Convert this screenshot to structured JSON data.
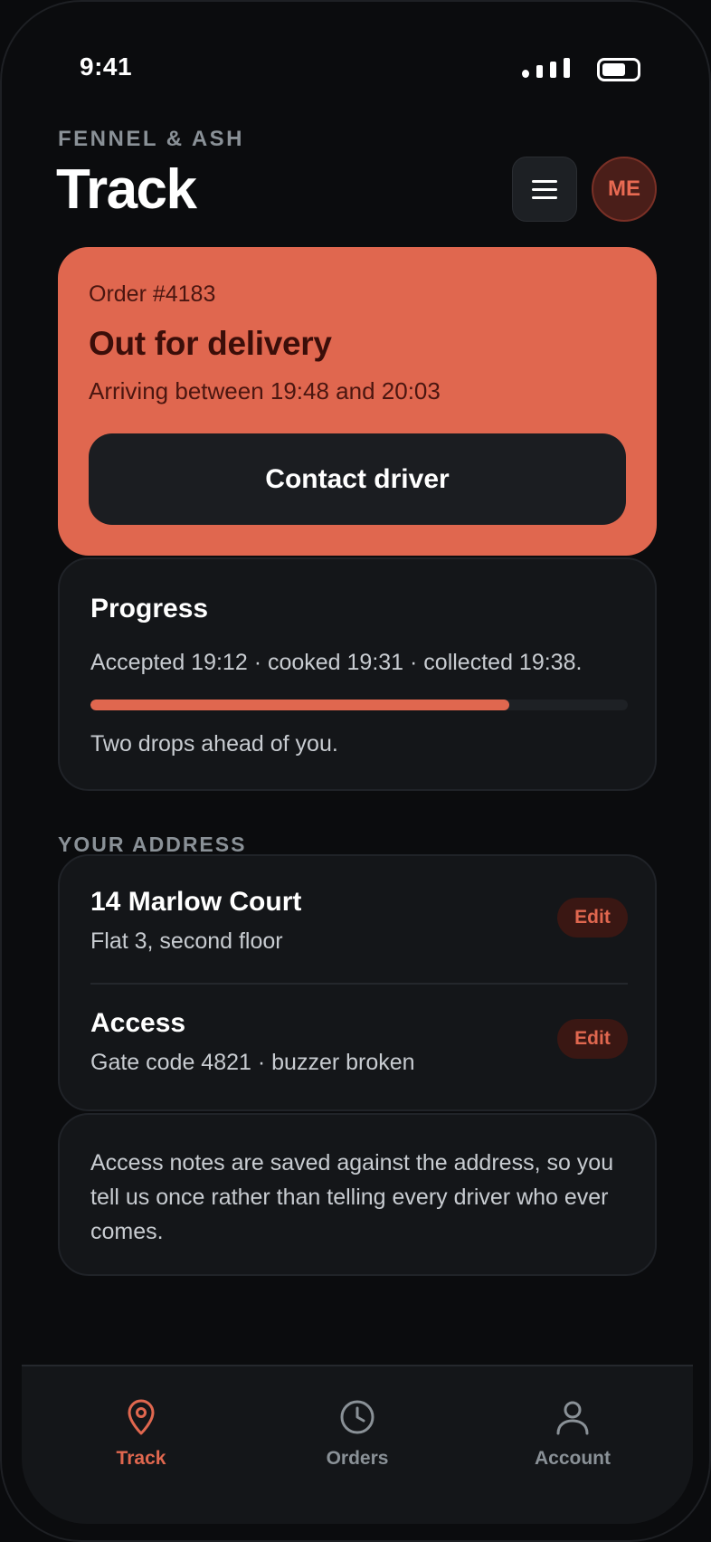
{
  "status_bar": {
    "time": "9:41"
  },
  "header": {
    "brand": "FENNEL & ASH",
    "title": "Track",
    "avatar_initials": "ME"
  },
  "order": {
    "number": "Order #4183",
    "status": "Out for delivery",
    "eta": "Arriving between 19:48 and 20:03",
    "contact_label": "Contact driver"
  },
  "progress": {
    "title": "Progress",
    "times": "Accepted 19:12 · cooked 19:31 · collected 19:38.",
    "percent": 78,
    "note": "Two drops ahead of you."
  },
  "address": {
    "section_label": "YOUR ADDRESS",
    "rows": [
      {
        "title": "14 Marlow Court",
        "detail": "Flat 3, second floor",
        "action": "Edit"
      },
      {
        "title": "Access",
        "detail": "Gate code 4821 · buzzer broken",
        "action": "Edit"
      }
    ],
    "note": "Access notes are saved against the address, so you tell us once rather than telling every driver who ever comes."
  },
  "tabbar": {
    "items": [
      {
        "label": "Track",
        "icon": "map-pin-icon",
        "active": true
      },
      {
        "label": "Orders",
        "icon": "clock-icon",
        "active": false
      },
      {
        "label": "Account",
        "icon": "user-icon",
        "active": false
      }
    ]
  },
  "colors": {
    "accent": "#e0674f",
    "background": "#0b0c0e",
    "card": "#141619",
    "muted_text": "#8a9197"
  }
}
